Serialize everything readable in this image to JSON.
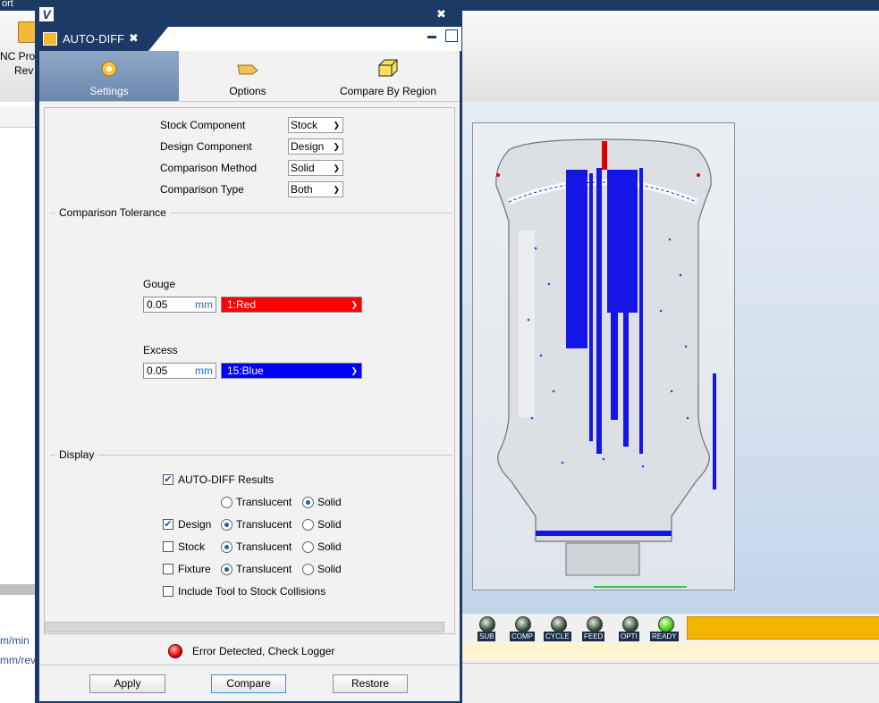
{
  "background": {
    "menu_fragment": "ort",
    "toolbar_item_label_line1": "NC Pro",
    "toolbar_item_label_line2": "Rev",
    "left_units": [
      "m/min",
      "mm/rev"
    ],
    "status_leds": [
      {
        "label": "SUB",
        "on": false
      },
      {
        "label": "COMP",
        "on": false
      },
      {
        "label": "CYCLE",
        "on": false
      },
      {
        "label": "FEED",
        "on": false
      },
      {
        "label": "OPTI",
        "on": false
      },
      {
        "label": "READY",
        "on": true
      }
    ]
  },
  "dialog": {
    "app_logo": "V",
    "close_glyph": "✖",
    "tab_title": "AUTO-DIFF",
    "tab_close": "✖",
    "subtabs": [
      {
        "label": "Settings",
        "icon": "gear-icon",
        "active": true
      },
      {
        "label": "Options",
        "icon": "hand-pointer-icon",
        "active": false
      },
      {
        "label": "Compare By Region",
        "icon": "box-region-icon",
        "active": false
      }
    ],
    "components": [
      {
        "label": "Stock Component",
        "value": "Stock"
      },
      {
        "label": "Design Component",
        "value": "Design"
      },
      {
        "label": "Comparison Method",
        "value": "Solid"
      },
      {
        "label": "Comparison Type",
        "value": "Both"
      }
    ],
    "tolerance": {
      "title": "Comparison Tolerance",
      "gouge": {
        "label": "Gouge",
        "value": "0.05",
        "unit": "mm",
        "color": "1:Red",
        "color_hex": "#ff0000"
      },
      "excess": {
        "label": "Excess",
        "value": "0.05",
        "unit": "mm",
        "color": "15:Blue",
        "color_hex": "#0000ff"
      }
    },
    "display": {
      "title": "Display",
      "results": {
        "label": "AUTO-DIFF Results",
        "checked": true,
        "translucent": "Translucent",
        "solid": "Solid",
        "mode": "solid"
      },
      "design": {
        "label": "Design",
        "checked": true,
        "translucent": "Translucent",
        "solid": "Solid",
        "mode": "translucent"
      },
      "stock": {
        "label": "Stock",
        "checked": false,
        "translucent": "Translucent",
        "solid": "Solid",
        "mode": "translucent"
      },
      "fixture": {
        "label": "Fixture",
        "checked": false,
        "translucent": "Translucent",
        "solid": "Solid",
        "mode": "translucent"
      },
      "include_tool": {
        "label": "Include Tool to Stock Collisions",
        "checked": false
      }
    },
    "error_text": "Error Detected, Check Logger",
    "buttons": {
      "apply": "Apply",
      "compare": "Compare",
      "restore": "Restore"
    }
  }
}
